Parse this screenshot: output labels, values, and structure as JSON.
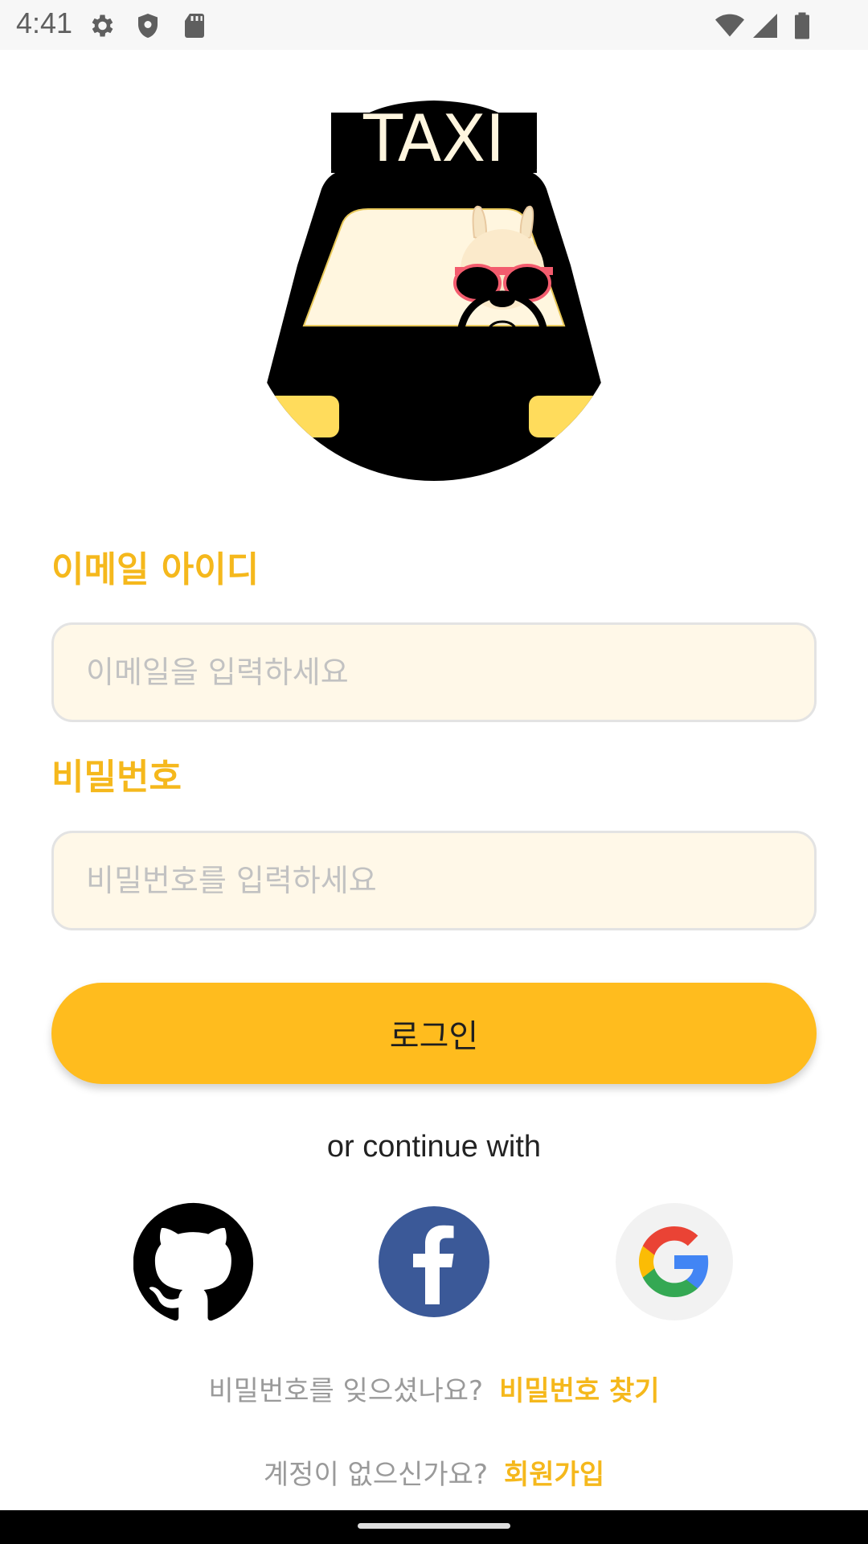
{
  "status_bar": {
    "time": "4:41",
    "icons": [
      "gear-icon",
      "shield-icon",
      "sd-card-icon",
      "wifi-icon",
      "signal-icon",
      "battery-icon"
    ]
  },
  "logo": {
    "sign_text": "TAXI"
  },
  "form": {
    "email_label": "이메일 아이디",
    "email_placeholder": "이메일을 입력하세요",
    "email_value": "",
    "password_label": "비밀번호",
    "password_placeholder": "비밀번호를 입력하세요",
    "password_value": "",
    "login_label": "로그인"
  },
  "social": {
    "continue_text": "or continue with",
    "providers": [
      "github-icon",
      "facebook-icon",
      "google-icon"
    ]
  },
  "links": {
    "forgot_question": "비밀번호를 잊으셨나요?",
    "forgot_link": "비밀번호 찾기",
    "signup_question": "계정이 없으신가요?",
    "signup_link": "회원가입"
  },
  "colors": {
    "accent": "#F5B81C",
    "button": "#FFBC1E",
    "input_bg": "#FFF8E8",
    "facebook": "#3B5998"
  }
}
